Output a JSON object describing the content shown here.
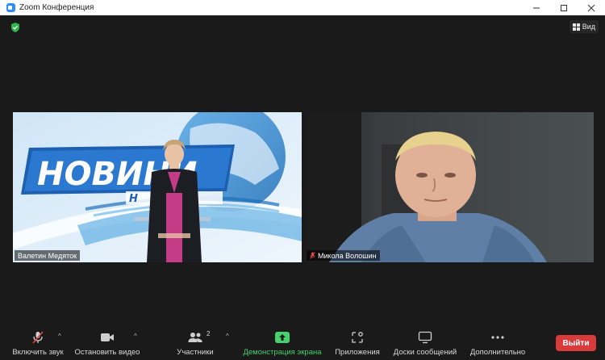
{
  "window": {
    "title": "Zoom Конференция"
  },
  "header": {
    "view_label": "Вид"
  },
  "participants": [
    {
      "name": "Валетин Медяток",
      "muted": false
    },
    {
      "name": "Микола Волошин",
      "muted": true
    }
  ],
  "broadcast": {
    "banner_text": "НОВИНИ",
    "banner_sub": "Н"
  },
  "toolbar": {
    "unmute_label": "Включить звук",
    "stop_video_label": "Остановить видео",
    "participants_label": "Участники",
    "participants_count": "2",
    "share_label": "Демонстрация экрана",
    "apps_label": "Приложения",
    "whiteboard_label": "Доски сообщений",
    "more_label": "Дополнительно",
    "leave_label": "Выйти"
  },
  "colors": {
    "accent_green": "#47d16c",
    "leave_red": "#d93b3b",
    "background": "#1a1a1a"
  }
}
